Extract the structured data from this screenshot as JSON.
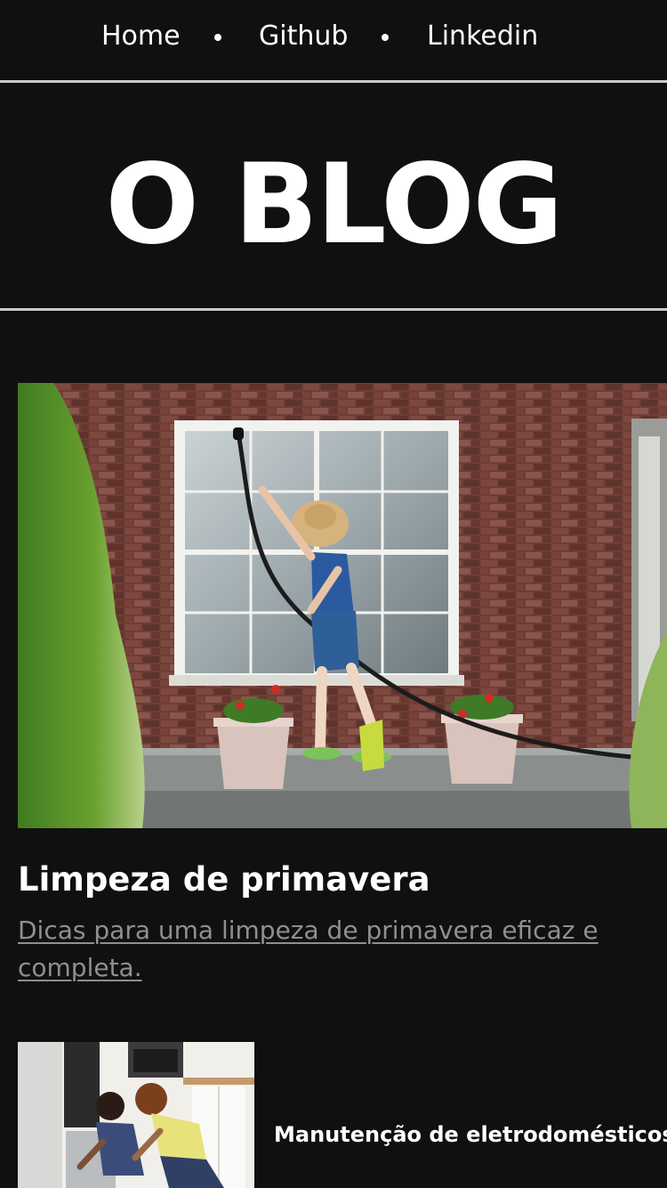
{
  "nav": {
    "items": [
      {
        "label": "Home"
      },
      {
        "label": "Github"
      },
      {
        "label": "Linkedin"
      }
    ]
  },
  "header": {
    "title": "O BLOG"
  },
  "featured_post": {
    "title": "Limpeza de primavera",
    "description": "Dicas para uma limpeza de primavera eficaz e completa."
  },
  "posts": [
    {
      "title": "Manutenção de eletrodomésticos"
    }
  ],
  "colors": {
    "background": "#101010",
    "text": "#ffffff",
    "muted_link": "#8f8f8f",
    "rule": "#c9c9c9"
  }
}
